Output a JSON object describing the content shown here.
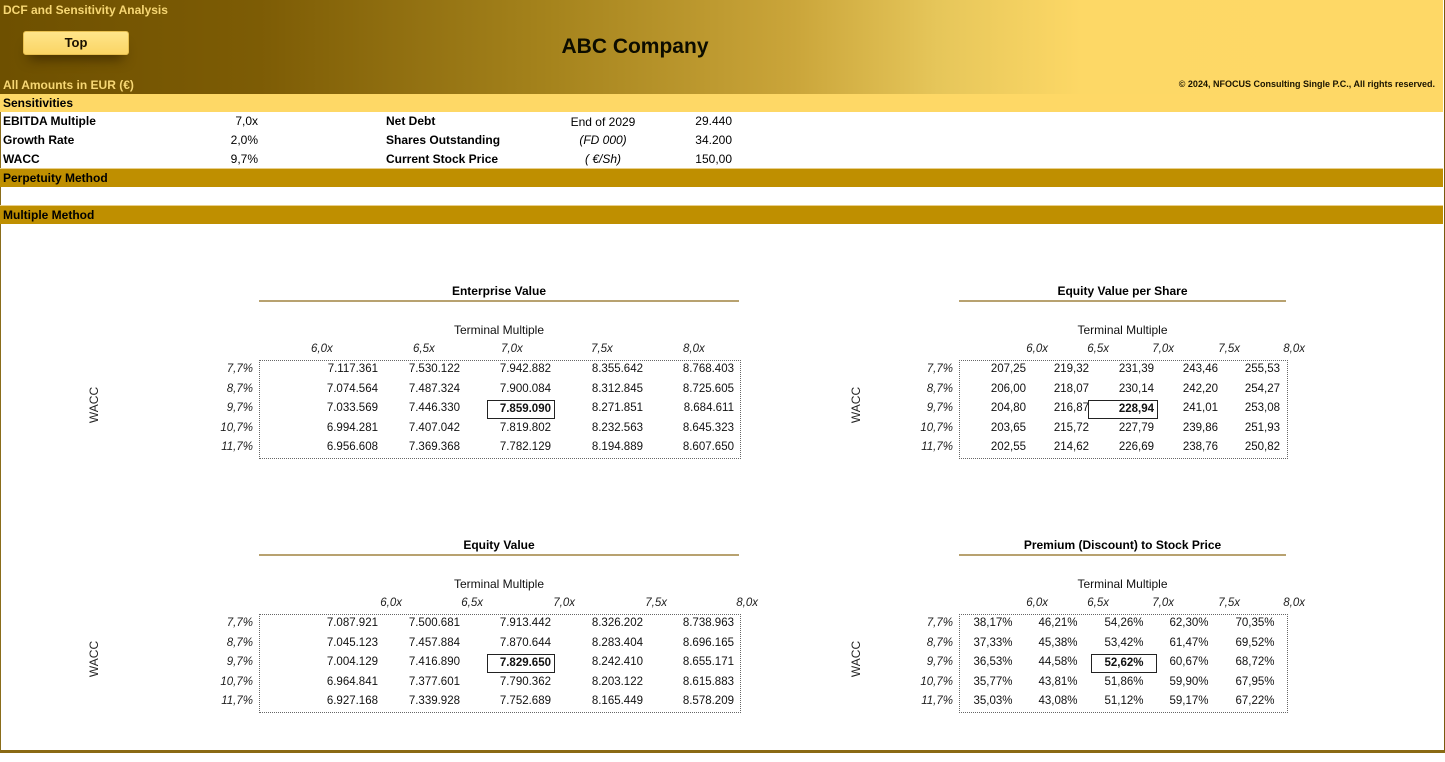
{
  "header": {
    "app_title": "DCF and Sensitivity Analysis",
    "top_button": "Top",
    "company": "ABC Company",
    "currency_note": "All Amounts in  EUR (€)",
    "copyright": "© 2024, NFOCUS Consulting Single P.C., All rights reserved."
  },
  "sections": {
    "sensitivities": "Sensitivities",
    "perpetuity": "Perpetuity Method",
    "multiple": "Multiple Method"
  },
  "inputs": {
    "ebitda_multiple": {
      "label": "EBITDA Multiple",
      "value": "7,0x"
    },
    "growth_rate": {
      "label": "Growth Rate",
      "value": "2,0%"
    },
    "wacc": {
      "label": "WACC",
      "value": "9,7%"
    },
    "net_debt": {
      "label": "Net Debt",
      "unit": "End of 2029",
      "value": "29.440"
    },
    "shares": {
      "label": "Shares Outstanding",
      "unit": "(FD 000)",
      "value": "34.200"
    },
    "stock_price": {
      "label": "Current Stock Price",
      "unit": "( €/Sh)",
      "value": "150,00"
    }
  },
  "tables": {
    "axis_col_label": "Terminal Multiple",
    "axis_row_label": "WACC",
    "col_headers": [
      "6,0x",
      "6,5x",
      "7,0x",
      "7,5x",
      "8,0x"
    ],
    "row_headers": [
      "7,7%",
      "8,7%",
      "9,7%",
      "10,7%",
      "11,7%"
    ],
    "highlight": {
      "row": 2,
      "col": 2
    },
    "enterprise_value": {
      "title": "Enterprise Value",
      "rows": [
        [
          "7.117.361",
          "7.530.122",
          "7.942.882",
          "8.355.642",
          "8.768.403"
        ],
        [
          "7.074.564",
          "7.487.324",
          "7.900.084",
          "8.312.845",
          "8.725.605"
        ],
        [
          "7.033.569",
          "7.446.330",
          "7.859.090",
          "8.271.851",
          "8.684.611"
        ],
        [
          "6.994.281",
          "7.407.042",
          "7.819.802",
          "8.232.563",
          "8.645.323"
        ],
        [
          "6.956.608",
          "7.369.368",
          "7.782.129",
          "8.194.889",
          "8.607.650"
        ]
      ]
    },
    "equity_value_per_share": {
      "title": "Equity Value per Share",
      "rows": [
        [
          "207,25",
          "219,32",
          "231,39",
          "243,46",
          "255,53"
        ],
        [
          "206,00",
          "218,07",
          "230,14",
          "242,20",
          "254,27"
        ],
        [
          "204,80",
          "216,87",
          "228,94",
          "241,01",
          "253,08"
        ],
        [
          "203,65",
          "215,72",
          "227,79",
          "239,86",
          "251,93"
        ],
        [
          "202,55",
          "214,62",
          "226,69",
          "238,76",
          "250,82"
        ]
      ]
    },
    "equity_value": {
      "title": "Equity Value",
      "rows": [
        [
          "7.087.921",
          "7.500.681",
          "7.913.442",
          "8.326.202",
          "8.738.963"
        ],
        [
          "7.045.123",
          "7.457.884",
          "7.870.644",
          "8.283.404",
          "8.696.165"
        ],
        [
          "7.004.129",
          "7.416.890",
          "7.829.650",
          "8.242.410",
          "8.655.171"
        ],
        [
          "6.964.841",
          "7.377.601",
          "7.790.362",
          "8.203.122",
          "8.615.883"
        ],
        [
          "6.927.168",
          "7.339.928",
          "7.752.689",
          "8.165.449",
          "8.578.209"
        ]
      ]
    },
    "premium_discount": {
      "title": "Premium (Discount) to Stock Price",
      "rows": [
        [
          "38,17%",
          "46,21%",
          "54,26%",
          "62,30%",
          "70,35%"
        ],
        [
          "37,33%",
          "45,38%",
          "53,42%",
          "61,47%",
          "69,52%"
        ],
        [
          "36,53%",
          "44,58%",
          "52,62%",
          "60,67%",
          "68,72%"
        ],
        [
          "35,77%",
          "43,81%",
          "51,86%",
          "59,90%",
          "67,95%"
        ],
        [
          "35,03%",
          "43,08%",
          "51,12%",
          "59,17%",
          "67,22%"
        ]
      ]
    }
  }
}
